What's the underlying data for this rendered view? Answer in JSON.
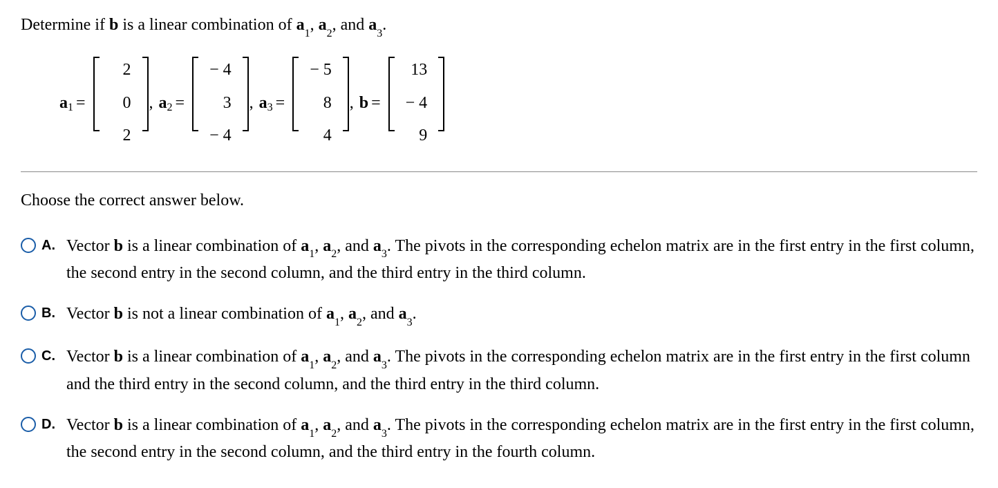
{
  "question": {
    "prefix": "Determine if ",
    "b": "b",
    "mid1": " is a linear combination of ",
    "a": "a",
    "sub1": "1",
    "c1": ", ",
    "sub2": "2",
    "c2": ", and ",
    "sub3": "3",
    "end": "."
  },
  "vectors": {
    "a1": {
      "label": "a",
      "sub": "1",
      "eq": "=",
      "vals": [
        "2",
        "0",
        "2"
      ]
    },
    "a2": {
      "label": "a",
      "sub": "2",
      "eq": "=",
      "vals": [
        "− 4",
        "3",
        "− 4"
      ]
    },
    "a3": {
      "label": "a",
      "sub": "3",
      "eq": "=",
      "vals": [
        "− 5",
        "8",
        "4"
      ]
    },
    "b": {
      "label": "b",
      "sub": "",
      "eq": "=",
      "vals": [
        "13",
        "− 4",
        "9"
      ]
    },
    "comma": ","
  },
  "choose": "Choose the correct answer below.",
  "options": {
    "A": {
      "letter": "A.",
      "pre": "Vector ",
      "b": "b",
      "mid": " is a linear combination of ",
      "a": "a",
      "s1": "1",
      "c1": ", ",
      "s2": "2",
      "c2": ", and ",
      "s3": "3",
      "tail": ". The pivots in the corresponding echelon matrix are in the first entry in the first column, the second entry in the second column, and the third entry in the third column."
    },
    "B": {
      "letter": "B.",
      "pre": "Vector ",
      "b": "b",
      "mid": " is not a linear combination of ",
      "a": "a",
      "s1": "1",
      "c1": ", ",
      "s2": "2",
      "c2": ", and ",
      "s3": "3",
      "tail": "."
    },
    "C": {
      "letter": "C.",
      "pre": "Vector ",
      "b": "b",
      "mid": " is a linear combination of ",
      "a": "a",
      "s1": "1",
      "c1": ", ",
      "s2": "2",
      "c2": ", and ",
      "s3": "3",
      "tail": ". The pivots in the corresponding echelon matrix are in the first entry in the first column and the third entry in the second column, and the third entry in the third column."
    },
    "D": {
      "letter": "D.",
      "pre": "Vector ",
      "b": "b",
      "mid": " is a linear combination of ",
      "a": "a",
      "s1": "1",
      "c1": ", ",
      "s2": "2",
      "c2": ", and ",
      "s3": "3",
      "tail": ". The pivots in the corresponding echelon matrix are in the first entry in the first column, the second entry in the second column, and the third entry in the fourth column."
    }
  }
}
